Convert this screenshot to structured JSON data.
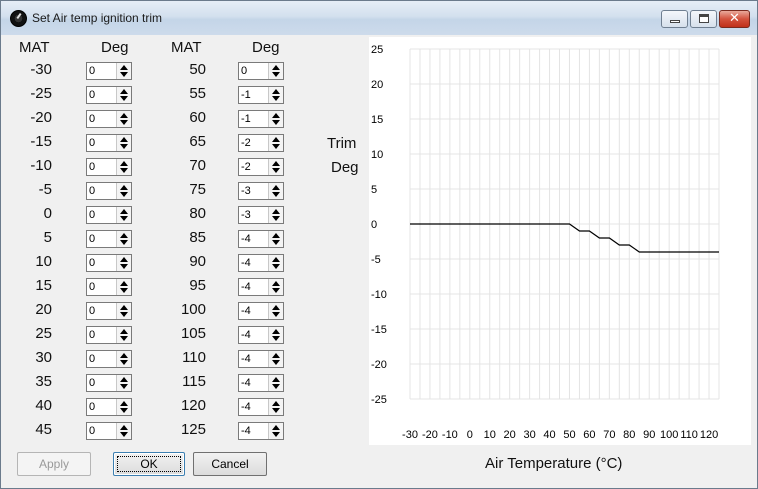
{
  "window": {
    "title": "Set Air temp ignition trim",
    "min_glyph": "",
    "close_glyph": "✕"
  },
  "headers": {
    "mat1": "MAT",
    "deg1": "Deg",
    "mat2": "MAT",
    "deg2": "Deg"
  },
  "left_table": [
    {
      "mat": "-30",
      "deg": "0"
    },
    {
      "mat": "-25",
      "deg": "0"
    },
    {
      "mat": "-20",
      "deg": "0"
    },
    {
      "mat": "-15",
      "deg": "0"
    },
    {
      "mat": "-10",
      "deg": "0"
    },
    {
      "mat": "-5",
      "deg": "0"
    },
    {
      "mat": "0",
      "deg": "0"
    },
    {
      "mat": "5",
      "deg": "0"
    },
    {
      "mat": "10",
      "deg": "0"
    },
    {
      "mat": "15",
      "deg": "0"
    },
    {
      "mat": "20",
      "deg": "0"
    },
    {
      "mat": "25",
      "deg": "0"
    },
    {
      "mat": "30",
      "deg": "0"
    },
    {
      "mat": "35",
      "deg": "0"
    },
    {
      "mat": "40",
      "deg": "0"
    },
    {
      "mat": "45",
      "deg": "0"
    }
  ],
  "right_table": [
    {
      "mat": "50",
      "deg": "0"
    },
    {
      "mat": "55",
      "deg": "-1"
    },
    {
      "mat": "60",
      "deg": "-1"
    },
    {
      "mat": "65",
      "deg": "-2"
    },
    {
      "mat": "70",
      "deg": "-2"
    },
    {
      "mat": "75",
      "deg": "-3"
    },
    {
      "mat": "80",
      "deg": "-3"
    },
    {
      "mat": "85",
      "deg": "-4"
    },
    {
      "mat": "90",
      "deg": "-4"
    },
    {
      "mat": "95",
      "deg": "-4"
    },
    {
      "mat": "100",
      "deg": "-4"
    },
    {
      "mat": "105",
      "deg": "-4"
    },
    {
      "mat": "110",
      "deg": "-4"
    },
    {
      "mat": "115",
      "deg": "-4"
    },
    {
      "mat": "120",
      "deg": "-4"
    },
    {
      "mat": "125",
      "deg": "-4"
    }
  ],
  "trim_label": {
    "line1": "Trim",
    "line2": "Deg"
  },
  "buttons": {
    "apply": "Apply",
    "ok": "OK",
    "cancel": "Cancel"
  },
  "chart_data": {
    "type": "line",
    "xlabel": "Air Temperature (°C)",
    "ylabel": "Trim Deg",
    "xlim": [
      -30,
      125
    ],
    "ylim": [
      -25,
      25
    ],
    "grid": true,
    "x_ticks": [
      "-30",
      "-20",
      "-10",
      "0",
      "10",
      "20",
      "30",
      "40",
      "50",
      "60",
      "70",
      "80",
      "90",
      "100",
      "110",
      "120"
    ],
    "y_ticks": [
      "25",
      "20",
      "15",
      "10",
      "5",
      "0",
      "-5",
      "-10",
      "-15",
      "-20",
      "-25"
    ],
    "x": [
      -30,
      -25,
      -20,
      -15,
      -10,
      -5,
      0,
      5,
      10,
      15,
      20,
      25,
      30,
      35,
      40,
      45,
      50,
      55,
      60,
      65,
      70,
      75,
      80,
      85,
      90,
      95,
      100,
      105,
      110,
      115,
      120,
      125
    ],
    "y": [
      0,
      0,
      0,
      0,
      0,
      0,
      0,
      0,
      0,
      0,
      0,
      0,
      0,
      0,
      0,
      0,
      0,
      -1,
      -1,
      -2,
      -2,
      -3,
      -3,
      -4,
      -4,
      -4,
      -4,
      -4,
      -4,
      -4,
      -4,
      -4
    ],
    "line_color": "#000000",
    "grid_color": "#e4e4e4"
  }
}
